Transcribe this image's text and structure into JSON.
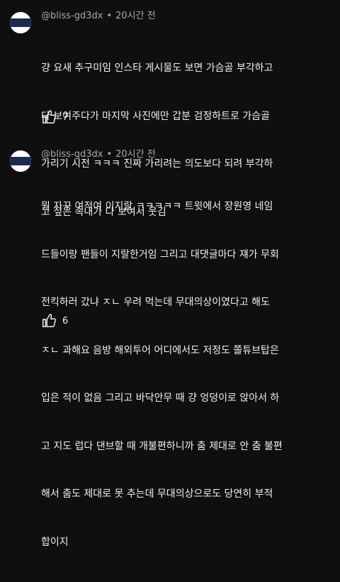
{
  "comments": [
    {
      "author": "@bliss-gd3dx",
      "separator": "•",
      "time": "20시간 전",
      "lines": [
        "걍 요새 추구미임 인스타 게시물도 보면 가슴골 부각하고",
        "다 보여주다가 마지막 사진에만 갑분 검정하트로 가슴골",
        "가리기 시전 ㅋㅋㅋ 진짜 가리려는 의도보다 되려 부각하",
        "고 싶은 속내가 다 보여서 웃김"
      ],
      "likes": "7",
      "like_icon": "thumbs-up-icon"
    },
    {
      "author": "@bliss-gd3dx",
      "separator": "•",
      "time": "20시간 전",
      "lines": [
        "뭔 자꾸 여적여 이지랄 ㅋㅋㅋㅋㅋ 트윗에서 장원영 네임",
        "드들이랑 팬들이 지랄한거임 그리고 대댓글마다 쟤가 무회",
        "전킥하러 갔냐 ㅈㄴ 우려 먹는데 무대의상이였다고 해도",
        "ㅈㄴ 과해요 음방 해외투어 어디에서도 저정도 쫄튜브탑은",
        "입은 적이 없음 그리고 바닥안무 때 걍 엉덩이로 앉아서 하",
        "고 지도 럽다 댄브할 때 개불편하니까 춤 제대로 안 춤 불편",
        "해서 춤도 제대로 못 추는데 무대의상으로도 당연히 부적",
        "합이지"
      ],
      "likes": "6",
      "like_icon": "thumbs-up-icon"
    }
  ],
  "avatar_colors": {
    "navy": "#1a2a52",
    "white": "#ffffff"
  }
}
